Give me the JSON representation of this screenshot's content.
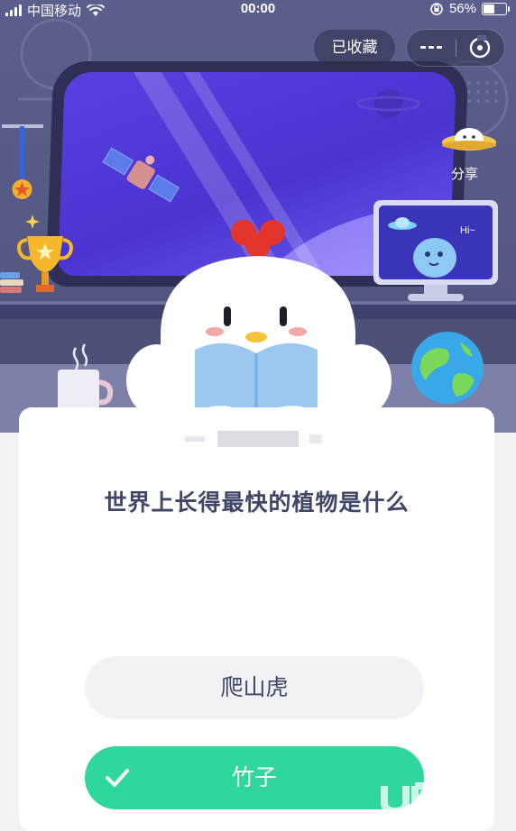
{
  "status_bar": {
    "carrier": "中国移动",
    "time": "00:00",
    "battery": "56%",
    "battery_fraction": 0.56
  },
  "header": {
    "favorited_label": "已收藏",
    "more_icon": "ellipsis-icon",
    "close_icon": "target-close-icon"
  },
  "scene": {
    "share_label": "分享",
    "monitor_text": "Hi~"
  },
  "quiz": {
    "question": "世界上长得最快的植物是什么",
    "options": [
      {
        "label": "爬山虎",
        "state": "default"
      },
      {
        "label": "竹子",
        "state": "correct"
      }
    ]
  },
  "colors": {
    "accent_green": "#2fd79a",
    "question_text": "#3f4668",
    "scene_bg": "#555984"
  }
}
